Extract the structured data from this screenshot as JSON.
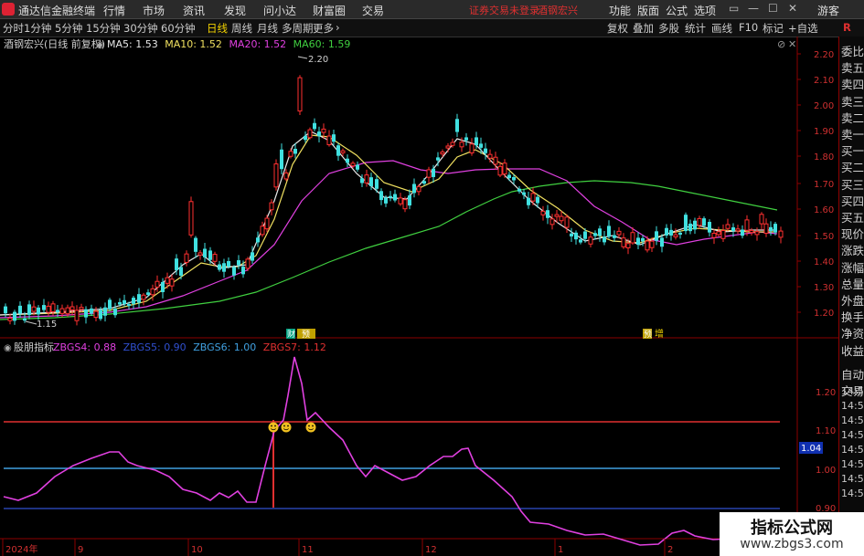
{
  "topbar": {
    "app_title": "通达信金融终端",
    "menus": [
      "行情",
      "市场",
      "资讯",
      "发现",
      "问小达",
      "财富圈",
      "交易"
    ],
    "warning": "证券交易未登录",
    "stock": "酒钢宏兴",
    "right_menus": [
      "功能",
      "版面",
      "公式",
      "选项"
    ],
    "window_controls": [
      "▭",
      "—",
      "☐",
      "✕"
    ],
    "guest": "游客"
  },
  "toolbar": {
    "timeframes": [
      "分时",
      "1分钟",
      "5分钟",
      "15分钟",
      "30分钟",
      "60分钟",
      "日线",
      "周线",
      "月线",
      "多周期",
      "更多"
    ],
    "active": "日线",
    "right_buttons": [
      "复权",
      "叠加",
      "多股",
      "统计",
      "画线",
      "F10",
      "标记",
      "+自选"
    ],
    "r_label": "R"
  },
  "main_chart": {
    "title": "酒钢宏兴(日线 前复权)",
    "ma_labels": [
      {
        "text": "MA5: 1.53",
        "color": "#e8e8e8"
      },
      {
        "text": "MA10: 1.52",
        "color": "#f0e060"
      },
      {
        "text": "MA20: 1.52",
        "color": "#e040e0"
      },
      {
        "text": "MA60: 1.59",
        "color": "#40d040"
      }
    ],
    "price_axis": [
      "2.20",
      "2.10",
      "2.00",
      "1.90",
      "1.80",
      "1.70",
      "1.60",
      "1.50",
      "1.40",
      "1.30",
      "1.20"
    ],
    "high_mark": "2.20",
    "low_mark": "1.15",
    "events": [
      "财",
      "预",
      "增"
    ]
  },
  "indicator": {
    "name": "股朋指标",
    "labels": [
      {
        "text": "ZBGS4: 0.88",
        "color": "#e040e0"
      },
      {
        "text": "ZBGS5: 0.90",
        "color": "#3050d0"
      },
      {
        "text": "ZBGS6: 1.00",
        "color": "#40a0e0"
      },
      {
        "text": "ZBGS7: 1.12",
        "color": "#e03030"
      }
    ],
    "axis": [
      "1.20",
      "1.10",
      "1.00",
      "0.90"
    ],
    "current_value": "1.04"
  },
  "x_axis": [
    "2024年",
    "9",
    "10",
    "11",
    "12",
    "1",
    "2"
  ],
  "right_panel": {
    "items": [
      "委比",
      "卖五",
      "卖四",
      "卖三",
      "卖二",
      "卖一",
      "买一",
      "买二",
      "买三",
      "买四",
      "买五",
      "现价",
      "涨跌",
      "涨幅",
      "总量",
      "外盘",
      "换手",
      "净资",
      "收益",
      "自动",
      "交易"
    ],
    "times": [
      "14:56",
      "14:56",
      "14:56",
      "14:56",
      "14:56",
      "14:56",
      "14:56",
      "14:56"
    ]
  },
  "colors": {
    "up": "#ff3030",
    "down": "#40e0e0",
    "ma5": "#e8e8e8",
    "ma10": "#f0e060",
    "ma20": "#e040e0",
    "ma60": "#40d040",
    "grid_red": "#8b0000"
  },
  "watermark": {
    "line1": "指标公式网",
    "line2": "www.zbgs3.com"
  }
}
